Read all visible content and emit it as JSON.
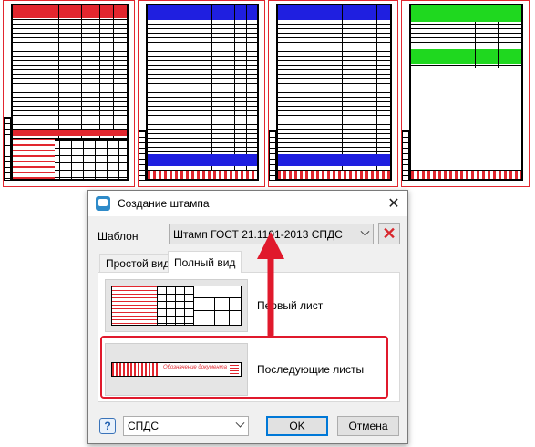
{
  "sheets": [
    {
      "name": "sheet-1",
      "header_color": "#e2262e"
    },
    {
      "name": "sheet-2",
      "header_color": "#1f1fe0"
    },
    {
      "name": "sheet-3",
      "header_color": "#1f1fe0"
    },
    {
      "name": "sheet-4",
      "header_color": "#1fd81f"
    }
  ],
  "dialog": {
    "title": "Создание штампа",
    "template_label": "Шаблон",
    "template_value": "Штамп ГОСТ 21.1101-2013 СПДС",
    "tabs": [
      "Простой вид",
      "Полный вид"
    ],
    "active_tab": "Полный вид",
    "options": {
      "first_sheet": "Первый лист",
      "next_sheets": "Последующие листы"
    },
    "thumb_text": "Обозначение документа",
    "help_label": "?",
    "standard_value": "СПДС",
    "ok_label": "OK",
    "cancel_label": "Отмена"
  },
  "colors": {
    "highlight": "#e0192c",
    "arrow": "#e0192c"
  }
}
